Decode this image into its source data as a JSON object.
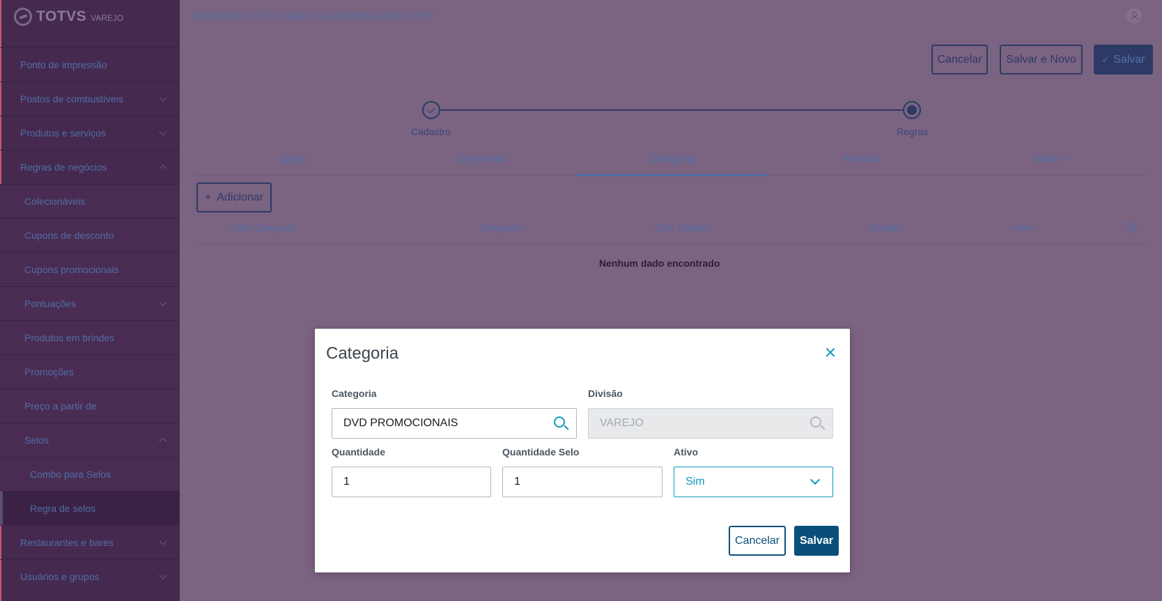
{
  "colors": {
    "overlay_bg": "#7b6382",
    "sidebar_bg": "#46294f",
    "accent": "#0c9abe",
    "primary": "#0a4f7a"
  },
  "logo": {
    "brand": "TOTVS",
    "sub": "VAREJO"
  },
  "sidebar": {
    "items": [
      {
        "label": "Ponto de impressão",
        "chevron": null
      },
      {
        "label": "Postos de combustíveis",
        "chevron": "down"
      },
      {
        "label": "Produtos e serviços",
        "chevron": "down"
      },
      {
        "label": "Regras de negócios",
        "chevron": "up"
      },
      {
        "label": "Colecionáveis",
        "chevron": null
      },
      {
        "label": "Cupons de desconto",
        "chevron": null
      },
      {
        "label": "Cupons promocionais",
        "chevron": null
      },
      {
        "label": "Pontuações",
        "chevron": "down"
      },
      {
        "label": "Produtos em brindes",
        "chevron": null
      },
      {
        "label": "Promoções",
        "chevron": null
      },
      {
        "label": "Preço a partir de",
        "chevron": null
      },
      {
        "label": "Selos",
        "chevron": "up"
      },
      {
        "label": "Combo para Selos",
        "chevron": null
      },
      {
        "label": "Regra de selos",
        "chevron": null
      },
      {
        "label": "Restaurantes e bares",
        "chevron": "down"
      },
      {
        "label": "Usuários e grupos",
        "chevron": "down"
      }
    ]
  },
  "header": {
    "server_title": "SERVIDOR TOTVS VAREJO SUPERMERCADOS PDV",
    "cancel_label": "Cancelar",
    "save_new_label": "Salvar e Novo",
    "save_label": "Salvar",
    "save_check": "✓"
  },
  "stepper": {
    "steps": [
      {
        "label": "Cadastro",
        "state": "done"
      },
      {
        "label": "Regras",
        "state": "current"
      }
    ]
  },
  "tabs": [
    {
      "label": "Lojas",
      "active": false
    },
    {
      "label": "Segmento",
      "active": false
    },
    {
      "label": "Categoria",
      "active": true
    },
    {
      "label": "Família",
      "active": false
    },
    {
      "label": "Mais",
      "active": false
    }
  ],
  "add_button": {
    "icon": "+",
    "label": "Adicionar"
  },
  "table": {
    "columns": [
      "Cód. Categoria",
      "Categoria",
      "Cód. Divisão",
      "Divisão",
      "Ativo"
    ],
    "empty_text": "Nenhum dado encontrado"
  },
  "modal": {
    "title": "Categoria",
    "fields": {
      "categoria": {
        "label": "Categoria",
        "value": "DVD PROMOCIONAIS"
      },
      "divisao": {
        "label": "Divisão",
        "value": "VAREJO"
      },
      "quantidade": {
        "label": "Quantidade",
        "value": "1"
      },
      "quantidade_selo": {
        "label": "Quantidade Selo",
        "value": "1"
      },
      "ativo": {
        "label": "Ativo",
        "value": "Sim"
      }
    },
    "cancel_label": "Cancelar",
    "save_label": "Salvar"
  }
}
